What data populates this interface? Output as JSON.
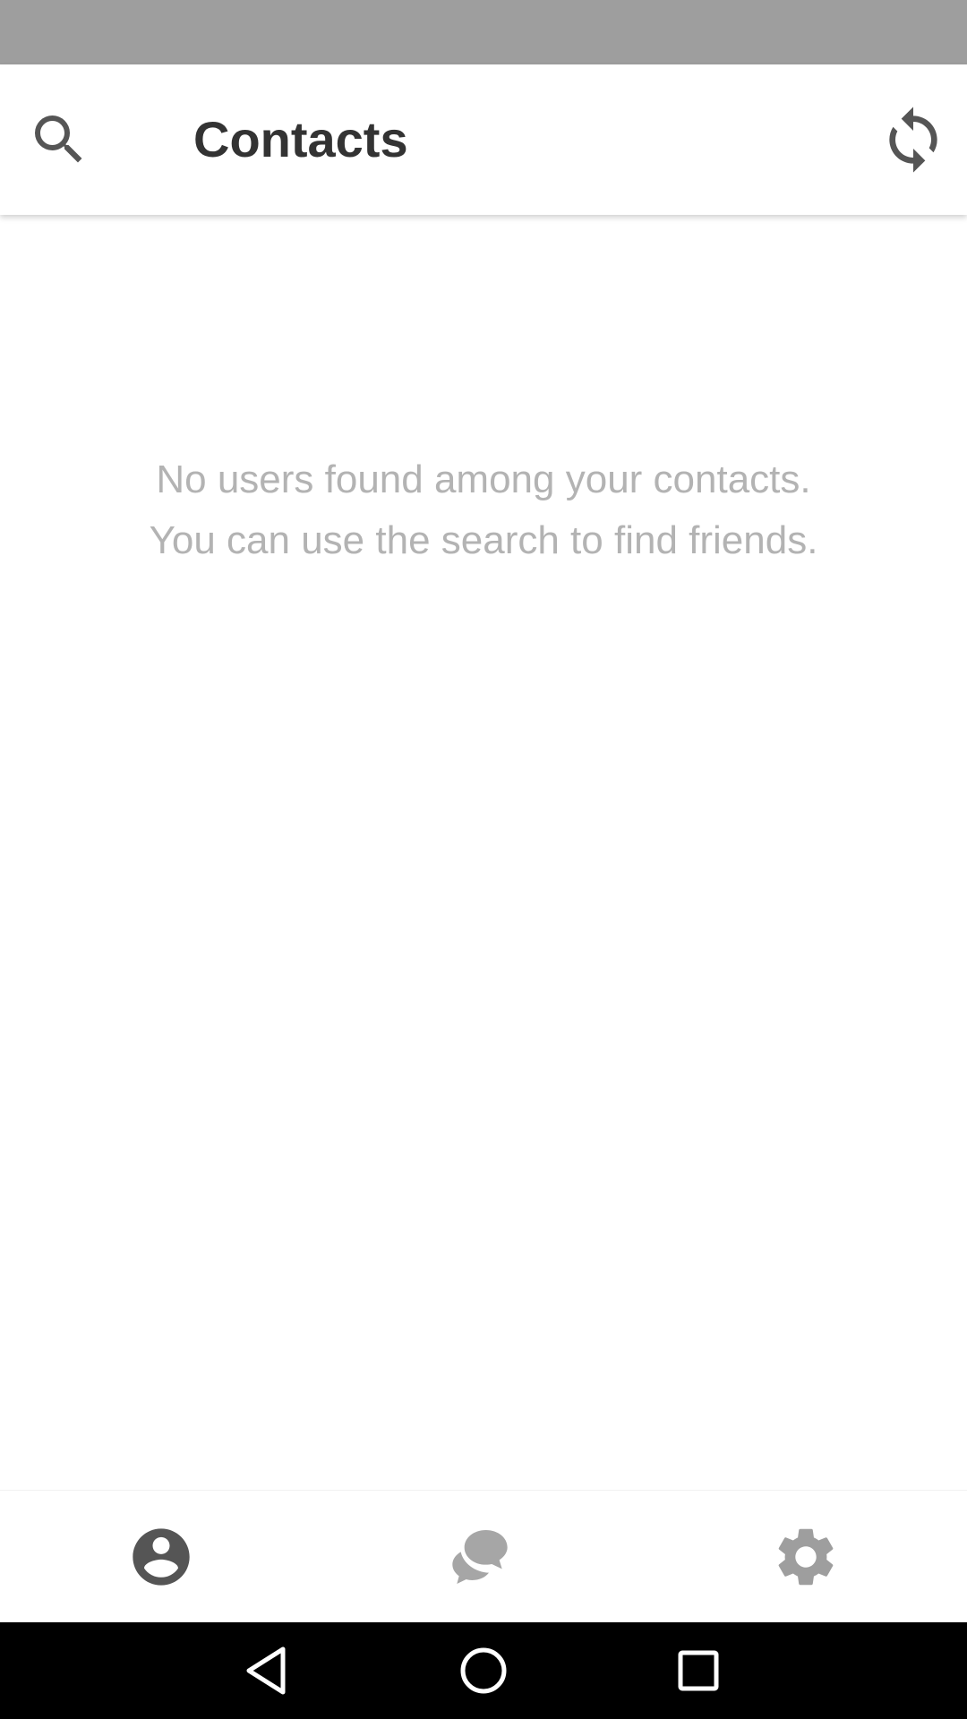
{
  "header": {
    "title": "Contacts",
    "left_icon": "search-icon",
    "right_icon": "sync-icon"
  },
  "empty_state": {
    "line1": "No users found among your contacts.",
    "line2": "You can use the search to find friends."
  },
  "bottom_nav": {
    "items": [
      {
        "id": "contacts",
        "icon": "account-circle-icon",
        "active": true
      },
      {
        "id": "chats",
        "icon": "chat-bubbles-icon",
        "active": false
      },
      {
        "id": "settings",
        "icon": "gear-icon",
        "active": false
      }
    ]
  },
  "system_nav": {
    "icons": [
      "back-triangle-icon",
      "home-circle-icon",
      "recents-square-icon"
    ]
  },
  "colors": {
    "status_bar": "#9e9e9e",
    "title_text": "#333333",
    "icon_dark": "#555555",
    "icon_inactive": "#9e9e9e",
    "empty_text": "#b3b3b3",
    "system_nav_bg": "#000000"
  }
}
